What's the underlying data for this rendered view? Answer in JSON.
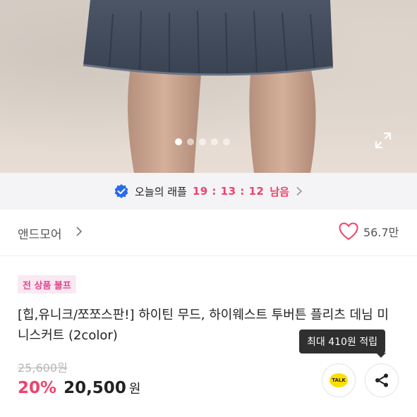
{
  "hero": {
    "image_subject": "denim-pleated-mini-skirt-photo",
    "slide_count": 5,
    "active_slide": 1
  },
  "raffle": {
    "icon": "verified-check-icon",
    "label": "오늘의 래플",
    "timer": "19 : 13 : 12",
    "suffix": "남음"
  },
  "store": {
    "name": "앤드모어",
    "likes": "56.7만"
  },
  "product": {
    "badge": "전 상품 불프",
    "title": "[힙,유니크/쪼쪼스판!] 하이틴 무드, 하이웨스트 투버튼 플리츠 데님 미니스커트 (2color)",
    "original_price": "25,600원",
    "discount": "20%",
    "price": "20,500",
    "currency": "원"
  },
  "reward": {
    "tooltip": "최대 410원 적립"
  },
  "actions": {
    "kakao_label": "TALK"
  },
  "colors": {
    "accent": "#f2416b",
    "badge_bg": "#fbe9f2",
    "badge_text": "#e2458f",
    "raffle_icon": "#2b6ae8"
  }
}
